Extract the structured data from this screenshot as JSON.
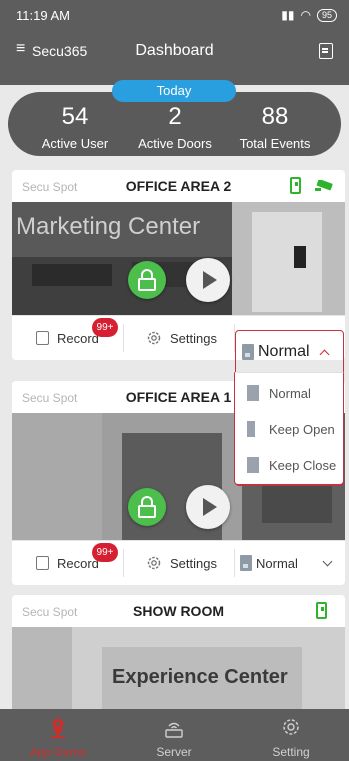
{
  "status": {
    "time": "11:19 AM",
    "battery": "95"
  },
  "header": {
    "app_name": "Secu365",
    "title": "Dashboard"
  },
  "stats": {
    "today_label": "Today",
    "active_user": {
      "value": "54",
      "label": "Active User"
    },
    "active_doors": {
      "value": "2",
      "label": "Active Doors"
    },
    "total_events": {
      "value": "88",
      "label": "Total Events"
    }
  },
  "cards": [
    {
      "spot": "Secu Spot",
      "area": "OFFICE AREA 2",
      "photo_text": "Marketing Center",
      "records_label": "Record",
      "badge": "99+",
      "settings_label": "Settings",
      "mode": "Normal"
    },
    {
      "spot": "Secu Spot",
      "area": "OFFICE AREA 1",
      "records_label": "Record",
      "badge": "99+",
      "settings_label": "Settings",
      "mode": "Normal"
    },
    {
      "spot": "Secu Spot",
      "area": "SHOW ROOM",
      "photo_text": "Experience Center"
    }
  ],
  "mode_menu": {
    "options": [
      "Normal",
      "Keep Open",
      "Keep Close"
    ]
  },
  "tabs": [
    {
      "label": "App Demo"
    },
    {
      "label": "Server"
    },
    {
      "label": "Setting"
    }
  ],
  "colors": {
    "accent": "#2a9fe0",
    "active_tab": "#c9302c",
    "badge": "#d62032",
    "door_green": "#2fb32f"
  }
}
